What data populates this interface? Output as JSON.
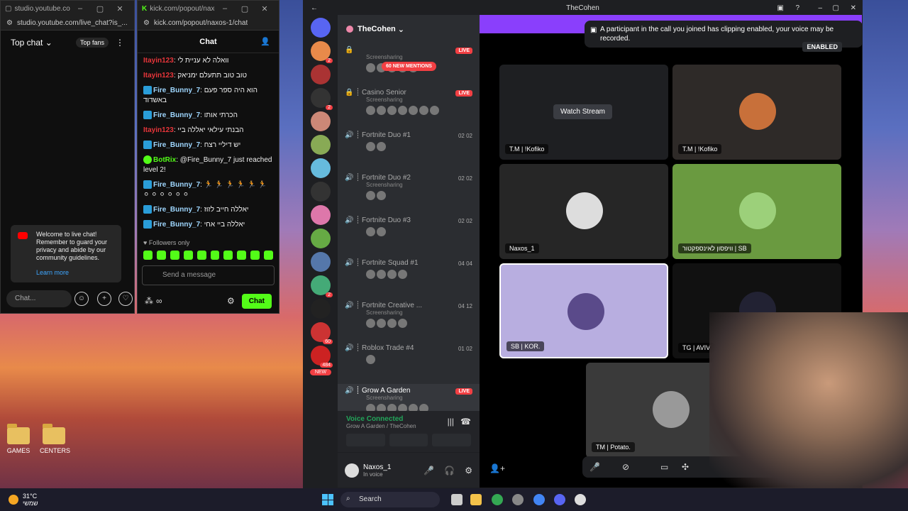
{
  "desktop": {
    "icons": [
      {
        "label": "GAMES"
      },
      {
        "label": "CENTERS"
      }
    ]
  },
  "youtube": {
    "tab_title": "studio.youtube.com...",
    "url": "studio.youtube.com/live_chat?is_...",
    "chat_mode": "Top chat",
    "top_fans": "Top fans",
    "welcome_text": "Welcome to live chat! Remember to guard your privacy and abide by our community guidelines.",
    "learn_more": "Learn more",
    "input_placeholder": "Chat..."
  },
  "kick": {
    "tab_title": "kick.com/popout/naxos-...",
    "url": "kick.com/popout/naxos-1/chat",
    "header": "Chat",
    "messages": [
      {
        "user": "Itayin123",
        "text": ": וואלה לא עניית לי",
        "color": "#e8353a"
      },
      {
        "user": "Itayin123",
        "text": ": טוב טוב תתעלם ימניאק",
        "color": "#e8353a"
      },
      {
        "user": "Fire_Bunny_7",
        "text": ": הוא היה ספר פעם באשדוד",
        "color": "#9fd7ff"
      },
      {
        "user": "Fire_Bunny_7",
        "text": ": הכרתי אותו",
        "color": "#9fd7ff"
      },
      {
        "user": "Itayin123",
        "text": ": הבנתי עילאי יאללה ביי",
        "color": "#e8353a"
      },
      {
        "user": "Fire_Bunny_7",
        "text": ": יש דיליי רצח",
        "color": "#9fd7ff"
      },
      {
        "user": "BotRix",
        "text": ": @Fire_Bunny_7 just reached level 2!",
        "color": "#53fc18"
      },
      {
        "user": "Fire_Bunny_7",
        "text": ": 🏃 🏃 🏃 🏃 🏃 🏃 ⚪ ⚪ ⚪ ⚪ ⚪ ⚪",
        "color": "#9fd7ff"
      },
      {
        "user": "Fire_Bunny_7",
        "text": ": יאללה חייב לזוז",
        "color": "#9fd7ff"
      },
      {
        "user": "Fire_Bunny_7",
        "text": ": יאללה ביי אחי",
        "color": "#9fd7ff"
      }
    ],
    "followers_only": "Followers only",
    "input_placeholder": "Send a message",
    "chat_button": "Chat",
    "infinity": "∞"
  },
  "discord": {
    "window_title": "TheCohen",
    "guild_name": "TheCohen",
    "mentions_badge": "60 NEW MENTIONS",
    "toast": "A participant in the call you joined has clipping enabled, your voice may be recorded.",
    "enabled_label": "ENABLED",
    "channels": [
      {
        "name": "",
        "sub": "Screensharing",
        "live": "LIVE",
        "count": ""
      },
      {
        "name": "┊ Casino Senior",
        "sub": "Screensharing",
        "live": "LIVE",
        "count": ""
      },
      {
        "name": "┊ Fortnite Duo #1",
        "sub": "",
        "live": "",
        "count": "02 02"
      },
      {
        "name": "┊ Fortnite Duo #2",
        "sub": "Screensharing",
        "live": "",
        "count": "02 02"
      },
      {
        "name": "┊ Fortnite Duo #3",
        "sub": "",
        "live": "",
        "count": "02 02"
      },
      {
        "name": "┊ Fortnite Squad #1",
        "sub": "",
        "live": "",
        "count": "04 04"
      },
      {
        "name": "┊ Fortnite Creative ...",
        "sub": "Screensharing",
        "live": "",
        "count": "04 12"
      },
      {
        "name": "┊ Roblox Trade #4",
        "sub": "",
        "live": "",
        "count": "01 02"
      },
      {
        "name": "┊ Grow A Garden",
        "sub": "Screensharing",
        "live": "LIVE",
        "count": ""
      }
    ],
    "server_badges": [
      "2",
      "",
      "2",
      "",
      "",
      "",
      "",
      "",
      "",
      "",
      "",
      "2",
      "",
      "60",
      "484"
    ],
    "new_label": "NEW",
    "voice_connected": "Voice Connected",
    "voice_sub": "Grow A Garden / TheCohen",
    "username": "Naxos_1",
    "user_status": "In voice",
    "tiles": [
      {
        "label": "T.M | !Kofiko",
        "watch": "Watch Stream"
      },
      {
        "label": "T.M | !Kofiko",
        "watch": ""
      },
      {
        "label": "Naxos_1",
        "watch": ""
      },
      {
        "label": "וויפסון לאינספקטור | SB",
        "watch": ""
      },
      {
        "label": "SB | KOR.",
        "watch": ""
      },
      {
        "label": "TG | AVIV",
        "watch": ""
      },
      {
        "label": "TM | Potato.",
        "watch": ""
      }
    ]
  },
  "taskbar": {
    "temp": "31°C",
    "weather_label": "שמשי",
    "search": "Search"
  }
}
